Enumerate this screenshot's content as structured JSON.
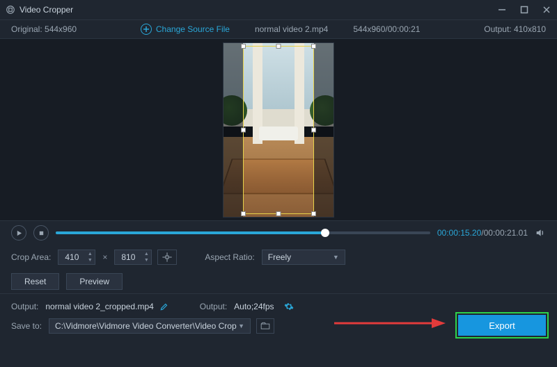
{
  "app": {
    "title": "Video Cropper"
  },
  "info": {
    "original": "Original:  544x960",
    "change_label": "Change Source File",
    "filename": "normal video 2.mp4",
    "src_meta": "544x960/00:00:21",
    "output": "Output: 410x810"
  },
  "playback": {
    "current": "00:00:15.20",
    "separator": "/",
    "total": "00:00:21.01"
  },
  "crop": {
    "area_label": "Crop Area:",
    "width": "410",
    "height": "810",
    "aspect_label": "Aspect Ratio:",
    "aspect_value": "Freely"
  },
  "buttons": {
    "reset": "Reset",
    "preview": "Preview",
    "export": "Export"
  },
  "output": {
    "file_label": "Output:",
    "file_value": "normal video 2_cropped.mp4",
    "fmt_label": "Output:",
    "fmt_value": "Auto;24fps"
  },
  "save": {
    "label": "Save to:",
    "path": "C:\\Vidmore\\Vidmore Video Converter\\Video Crop"
  }
}
